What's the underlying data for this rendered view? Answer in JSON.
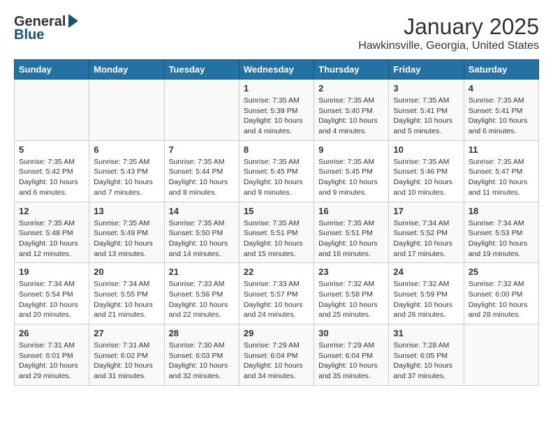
{
  "header": {
    "logo_general": "General",
    "logo_blue": "Blue",
    "month_title": "January 2025",
    "location": "Hawkinsville, Georgia, United States"
  },
  "weekdays": [
    "Sunday",
    "Monday",
    "Tuesday",
    "Wednesday",
    "Thursday",
    "Friday",
    "Saturday"
  ],
  "weeks": [
    [
      {
        "day": "",
        "info": ""
      },
      {
        "day": "",
        "info": ""
      },
      {
        "day": "",
        "info": ""
      },
      {
        "day": "1",
        "info": "Sunrise: 7:35 AM\nSunset: 5:39 PM\nDaylight: 10 hours\nand 4 minutes."
      },
      {
        "day": "2",
        "info": "Sunrise: 7:35 AM\nSunset: 5:40 PM\nDaylight: 10 hours\nand 4 minutes."
      },
      {
        "day": "3",
        "info": "Sunrise: 7:35 AM\nSunset: 5:41 PM\nDaylight: 10 hours\nand 5 minutes."
      },
      {
        "day": "4",
        "info": "Sunrise: 7:35 AM\nSunset: 5:41 PM\nDaylight: 10 hours\nand 6 minutes."
      }
    ],
    [
      {
        "day": "5",
        "info": "Sunrise: 7:35 AM\nSunset: 5:42 PM\nDaylight: 10 hours\nand 6 minutes."
      },
      {
        "day": "6",
        "info": "Sunrise: 7:35 AM\nSunset: 5:43 PM\nDaylight: 10 hours\nand 7 minutes."
      },
      {
        "day": "7",
        "info": "Sunrise: 7:35 AM\nSunset: 5:44 PM\nDaylight: 10 hours\nand 8 minutes."
      },
      {
        "day": "8",
        "info": "Sunrise: 7:35 AM\nSunset: 5:45 PM\nDaylight: 10 hours\nand 9 minutes."
      },
      {
        "day": "9",
        "info": "Sunrise: 7:35 AM\nSunset: 5:45 PM\nDaylight: 10 hours\nand 9 minutes."
      },
      {
        "day": "10",
        "info": "Sunrise: 7:35 AM\nSunset: 5:46 PM\nDaylight: 10 hours\nand 10 minutes."
      },
      {
        "day": "11",
        "info": "Sunrise: 7:35 AM\nSunset: 5:47 PM\nDaylight: 10 hours\nand 11 minutes."
      }
    ],
    [
      {
        "day": "12",
        "info": "Sunrise: 7:35 AM\nSunset: 5:48 PM\nDaylight: 10 hours\nand 12 minutes."
      },
      {
        "day": "13",
        "info": "Sunrise: 7:35 AM\nSunset: 5:49 PM\nDaylight: 10 hours\nand 13 minutes."
      },
      {
        "day": "14",
        "info": "Sunrise: 7:35 AM\nSunset: 5:50 PM\nDaylight: 10 hours\nand 14 minutes."
      },
      {
        "day": "15",
        "info": "Sunrise: 7:35 AM\nSunset: 5:51 PM\nDaylight: 10 hours\nand 15 minutes."
      },
      {
        "day": "16",
        "info": "Sunrise: 7:35 AM\nSunset: 5:51 PM\nDaylight: 10 hours\nand 16 minutes."
      },
      {
        "day": "17",
        "info": "Sunrise: 7:34 AM\nSunset: 5:52 PM\nDaylight: 10 hours\nand 17 minutes."
      },
      {
        "day": "18",
        "info": "Sunrise: 7:34 AM\nSunset: 5:53 PM\nDaylight: 10 hours\nand 19 minutes."
      }
    ],
    [
      {
        "day": "19",
        "info": "Sunrise: 7:34 AM\nSunset: 5:54 PM\nDaylight: 10 hours\nand 20 minutes."
      },
      {
        "day": "20",
        "info": "Sunrise: 7:34 AM\nSunset: 5:55 PM\nDaylight: 10 hours\nand 21 minutes."
      },
      {
        "day": "21",
        "info": "Sunrise: 7:33 AM\nSunset: 5:56 PM\nDaylight: 10 hours\nand 22 minutes."
      },
      {
        "day": "22",
        "info": "Sunrise: 7:33 AM\nSunset: 5:57 PM\nDaylight: 10 hours\nand 24 minutes."
      },
      {
        "day": "23",
        "info": "Sunrise: 7:32 AM\nSunset: 5:58 PM\nDaylight: 10 hours\nand 25 minutes."
      },
      {
        "day": "24",
        "info": "Sunrise: 7:32 AM\nSunset: 5:59 PM\nDaylight: 10 hours\nand 26 minutes."
      },
      {
        "day": "25",
        "info": "Sunrise: 7:32 AM\nSunset: 6:00 PM\nDaylight: 10 hours\nand 28 minutes."
      }
    ],
    [
      {
        "day": "26",
        "info": "Sunrise: 7:31 AM\nSunset: 6:01 PM\nDaylight: 10 hours\nand 29 minutes."
      },
      {
        "day": "27",
        "info": "Sunrise: 7:31 AM\nSunset: 6:02 PM\nDaylight: 10 hours\nand 31 minutes."
      },
      {
        "day": "28",
        "info": "Sunrise: 7:30 AM\nSunset: 6:03 PM\nDaylight: 10 hours\nand 32 minutes."
      },
      {
        "day": "29",
        "info": "Sunrise: 7:29 AM\nSunset: 6:04 PM\nDaylight: 10 hours\nand 34 minutes."
      },
      {
        "day": "30",
        "info": "Sunrise: 7:29 AM\nSunset: 6:04 PM\nDaylight: 10 hours\nand 35 minutes."
      },
      {
        "day": "31",
        "info": "Sunrise: 7:28 AM\nSunset: 6:05 PM\nDaylight: 10 hours\nand 37 minutes."
      },
      {
        "day": "",
        "info": ""
      }
    ]
  ]
}
